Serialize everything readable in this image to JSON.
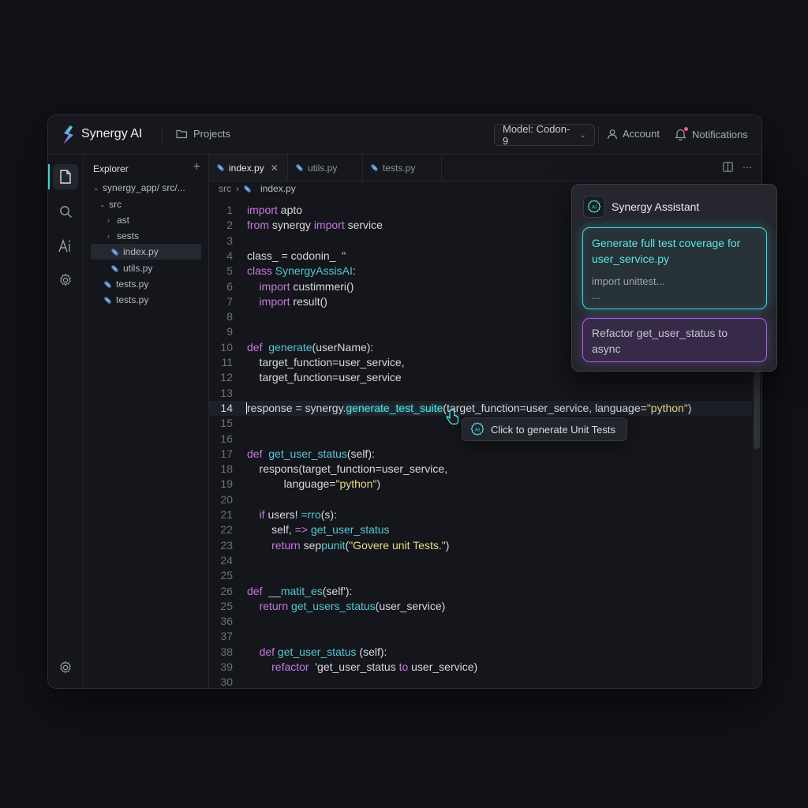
{
  "colors": {
    "accent_cyan": "#3fd9dc",
    "accent_purple": "#a463e6",
    "keyword": "#c678dd",
    "function": "#56c7d3",
    "string": "#e6d98a",
    "notification_dot": "#ff5a6e"
  },
  "header": {
    "app_name": "Synergy AI",
    "projects_label": "Projects",
    "model_select": "Model: Codon-9",
    "account_label": "Account",
    "notifications_label": "Notifications"
  },
  "activity_bar": {
    "items": [
      "files-icon",
      "search-icon",
      "ai-icon",
      "gear-icon"
    ],
    "bottom": "settings-icon"
  },
  "explorer": {
    "title": "Explorer",
    "items": [
      {
        "label": "synergy_app/ src/...",
        "type": "folder-open"
      },
      {
        "label": "src",
        "type": "folder-open"
      },
      {
        "label": "ast",
        "type": "folder-closed"
      },
      {
        "label": "sests",
        "type": "folder-closed"
      },
      {
        "label": "index.py",
        "type": "file",
        "selected": true
      },
      {
        "label": "utils.py",
        "type": "file"
      },
      {
        "label": "tests.py",
        "type": "file"
      },
      {
        "label": "tests.py",
        "type": "file"
      }
    ]
  },
  "tabs": [
    {
      "label": "index.py",
      "active": true,
      "closable": true
    },
    {
      "label": "utils.py",
      "active": false
    },
    {
      "label": "tests.py",
      "active": false
    }
  ],
  "breadcrumb": {
    "root": "src",
    "file": "index.py"
  },
  "editor": {
    "highlighted_line": "14",
    "lines": [
      {
        "n": "1",
        "tokens": [
          [
            "kw",
            "import"
          ],
          [
            "t",
            " apto"
          ]
        ]
      },
      {
        "n": "2",
        "tokens": [
          [
            "kw",
            "from"
          ],
          [
            "t",
            " synergy "
          ],
          [
            "kw",
            "import"
          ],
          [
            "t",
            " service"
          ]
        ]
      },
      {
        "n": "3",
        "tokens": []
      },
      {
        "n": "4",
        "tokens": [
          [
            "t",
            "class_ = codonin_  \""
          ]
        ]
      },
      {
        "n": "5",
        "tokens": [
          [
            "kw",
            "class"
          ],
          [
            "fn",
            " SynergyAssisAI"
          ],
          [
            "t",
            ":"
          ]
        ]
      },
      {
        "n": "6",
        "tokens": [
          [
            "t",
            "    "
          ],
          [
            "kw",
            "import"
          ],
          [
            "t",
            " custimmeri()"
          ]
        ]
      },
      {
        "n": "7",
        "tokens": [
          [
            "t",
            "    "
          ],
          [
            "kw",
            "import"
          ],
          [
            "t",
            " result()"
          ]
        ]
      },
      {
        "n": "8",
        "tokens": []
      },
      {
        "n": "9",
        "tokens": []
      },
      {
        "n": "10",
        "tokens": [
          [
            "kw",
            "def"
          ],
          [
            "t",
            "  "
          ],
          [
            "fn",
            "generate"
          ],
          [
            "t",
            "(userName):"
          ]
        ]
      },
      {
        "n": "11",
        "tokens": [
          [
            "t",
            "    target_function=user_service,"
          ]
        ]
      },
      {
        "n": "12",
        "tokens": [
          [
            "t",
            "    target_function=user_service"
          ]
        ]
      },
      {
        "n": "13",
        "tokens": []
      },
      {
        "n": "14",
        "tokens": [
          [
            "t",
            "response = synergy."
          ],
          [
            "glow",
            "generate_test_suite"
          ],
          [
            "t",
            "(target_function=user_service, language="
          ],
          [
            "str",
            "\"python\""
          ],
          [
            "t",
            ")"
          ]
        ]
      },
      {
        "n": "15",
        "tokens": []
      },
      {
        "n": "16",
        "tokens": []
      },
      {
        "n": "17",
        "tokens": [
          [
            "kw",
            "def"
          ],
          [
            "t",
            "  "
          ],
          [
            "fn",
            "get_user_status"
          ],
          [
            "t",
            "(self):"
          ]
        ]
      },
      {
        "n": "18",
        "tokens": [
          [
            "t",
            "    respons(target_function=user_service,"
          ]
        ]
      },
      {
        "n": "19",
        "tokens": [
          [
            "t",
            "            language="
          ],
          [
            "str",
            "\"python\""
          ],
          [
            "t",
            ")"
          ]
        ]
      },
      {
        "n": "20",
        "tokens": []
      },
      {
        "n": "21",
        "tokens": [
          [
            "t",
            "    "
          ],
          [
            "kw",
            "if"
          ],
          [
            "t",
            " users! "
          ],
          [
            "fn",
            "=rro"
          ],
          [
            "t",
            "(s):"
          ]
        ]
      },
      {
        "n": "22",
        "tokens": [
          [
            "t",
            "        self, "
          ],
          [
            "kw",
            "=>"
          ],
          [
            "t",
            " "
          ],
          [
            "fn",
            "get_user_status"
          ]
        ]
      },
      {
        "n": "23",
        "tokens": [
          [
            "t",
            "        "
          ],
          [
            "kw",
            "return"
          ],
          [
            "t",
            " sep"
          ],
          [
            "fn",
            "punit"
          ],
          [
            "t",
            "("
          ],
          [
            "str",
            "\"Govere unit Tests.\""
          ],
          [
            "t",
            ")"
          ]
        ]
      },
      {
        "n": "24",
        "tokens": []
      },
      {
        "n": "25",
        "tokens": []
      },
      {
        "n": "26",
        "tokens": [
          [
            "kw",
            "def"
          ],
          [
            "t",
            "  __"
          ],
          [
            "fn",
            "matit_es"
          ],
          [
            "t",
            "(self'):"
          ]
        ]
      },
      {
        "n": "25",
        "tokens": [
          [
            "t",
            "    "
          ],
          [
            "kw",
            "return"
          ],
          [
            "fn",
            " get_users_status"
          ],
          [
            "t",
            "(user_service)"
          ]
        ]
      },
      {
        "n": "36",
        "tokens": []
      },
      {
        "n": "37",
        "tokens": []
      },
      {
        "n": "38",
        "tokens": [
          [
            "t",
            "    "
          ],
          [
            "kw",
            "def"
          ],
          [
            "fn",
            " get_user_status"
          ],
          [
            "t",
            " (self):"
          ]
        ]
      },
      {
        "n": "39",
        "tokens": [
          [
            "t",
            "        "
          ],
          [
            "kw",
            "refactor"
          ],
          [
            "t",
            "  'get_user_status "
          ],
          [
            "kw",
            "to"
          ],
          [
            "t",
            " user_service)"
          ]
        ]
      },
      {
        "n": "30",
        "tokens": []
      }
    ]
  },
  "tooltip": {
    "label": "Click to generate Unit Tests"
  },
  "assistant": {
    "title": "Synergy Assistant",
    "suggestion_title": "Generate full test coverage for user_service.py",
    "suggestion_body": "import unittest...\n...",
    "refactor_label": "Refactor get_user_status to async"
  }
}
